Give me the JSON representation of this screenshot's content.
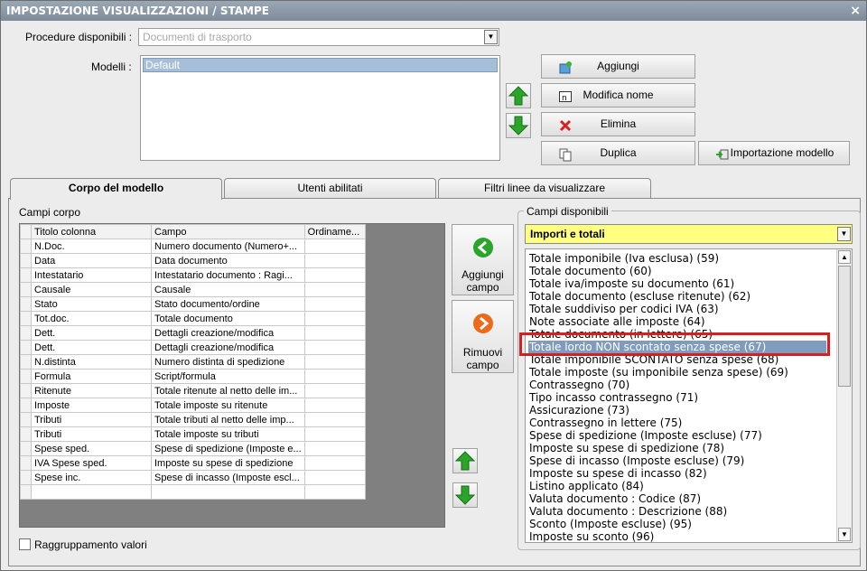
{
  "window": {
    "title": "IMPOSTAZIONE VISUALIZZAZIONI / STAMPE",
    "close_glyph": "×"
  },
  "procedure": {
    "label": "Procedure disponibili :",
    "value": "Documenti di trasporto"
  },
  "models": {
    "label": "Modelli :",
    "items": [
      "Default"
    ]
  },
  "buttons": {
    "aggiungi": "Aggiungi",
    "modifica": "Modifica nome",
    "elimina": "Elimina",
    "duplica": "Duplica",
    "importazione": "Importazione modello"
  },
  "tabs": [
    "Corpo del modello",
    "Utenti abilitati",
    "Filtri linee da visualizzare"
  ],
  "campi_corpo": {
    "label": "Campi corpo",
    "headers": [
      "Titolo colonna",
      "Campo",
      "Ordiname..."
    ],
    "rows": [
      [
        "N.Doc.",
        "Numero documento (Numero+..."
      ],
      [
        "Data",
        "Data documento"
      ],
      [
        "Intestatario",
        "Intestatario documento : Ragi..."
      ],
      [
        "Causale",
        "Causale"
      ],
      [
        "Stato",
        "Stato documento/ordine"
      ],
      [
        "Tot.doc.",
        "Totale documento"
      ],
      [
        "Dett.",
        "Dettagli creazione/modifica"
      ],
      [
        "Dett.",
        "Dettagli creazione/modifica"
      ],
      [
        "N.distinta",
        "Numero distinta di spedizione"
      ],
      [
        "Formula",
        "Script/formula"
      ],
      [
        "Ritenute",
        "Totale ritenute al netto delle im..."
      ],
      [
        "Imposte",
        "Totale imposte su ritenute"
      ],
      [
        "Tributi",
        "Totale tributi al netto delle imp..."
      ],
      [
        "Tributi",
        "Totale imposte su tributi"
      ],
      [
        "Spese sped.",
        "Spese di spedizione (Imposte e..."
      ],
      [
        "IVA Spese sped.",
        "Imposte su spese di spedizione"
      ],
      [
        "Spese inc.",
        "Spese di incasso (Imposte escl..."
      ],
      [
        "",
        ""
      ]
    ]
  },
  "side_buttons": {
    "aggiungi_campo": [
      "Aggiungi",
      "campo"
    ],
    "rimuovi_campo": [
      "Rimuovi",
      "campo"
    ]
  },
  "raggruppamento": {
    "label": "Raggruppamento valori",
    "checked": false
  },
  "campi_disponibili": {
    "label": "Campi disponibili",
    "category": "Importi e totali",
    "selected_index": 7,
    "items": [
      "Totale imponibile (Iva esclusa) (59)",
      "Totale documento (60)",
      "Totale iva/imposte su documento (61)",
      "Totale documento (escluse ritenute) (62)",
      "Totale suddiviso per codici IVA (63)",
      "Note associate alle imposte (64)",
      "Totale documento (in lettere) (65)",
      "Totale lordo NON scontato senza spese (67)",
      "Totale imponibile SCONTATO senza spese (68)",
      "Totale imposte (su imponibile senza spese) (69)",
      "Contrassegno (70)",
      "Tipo incasso contrassegno (71)",
      "Assicurazione (73)",
      "Contrassegno in lettere (75)",
      "Spese di spedizione (Imposte escluse) (77)",
      "Imposte su spese di spedizione (78)",
      "Spese di incasso (Imposte escluse) (79)",
      "Imposte su spese di incasso (82)",
      "Listino applicato (84)",
      "Valuta documento : Codice (87)",
      "Valuta documento : Descrizione (88)",
      "Sconto (Imposte escluse) (95)",
      "Imposte su sconto (96)"
    ]
  },
  "colors": {
    "highlight": "#d62020",
    "selection": "#7f9bbd",
    "category_bg": "#ffff80",
    "arrow_green": "#2aa52a"
  }
}
